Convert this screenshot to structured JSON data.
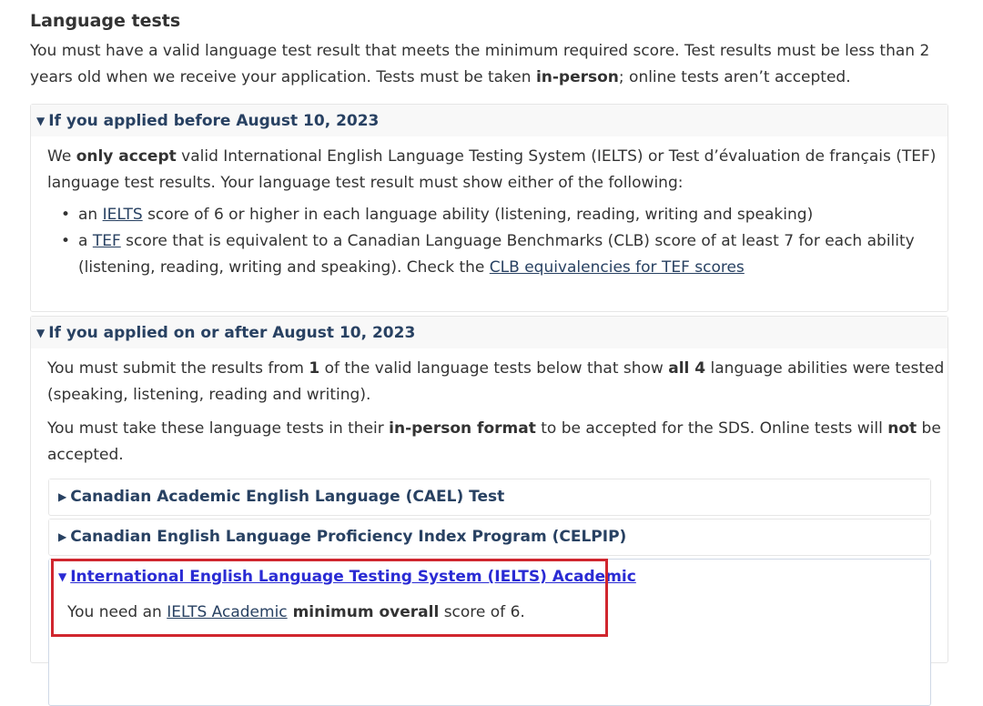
{
  "section": {
    "title": "Language tests",
    "intro_1": "You must have a valid language test result that meets the minimum required score. Test results must be less than 2 years old when we receive your application. Tests must be taken ",
    "intro_bold": "in-person",
    "intro_2": "; online tests aren’t accepted."
  },
  "before": {
    "summary": "If you applied before August 10, 2023",
    "p_1": "We ",
    "p_bold": "only accept",
    "p_2": " valid International English Language Testing System (IELTS) or Test d’évaluation de français (TEF) language test results. Your language test result must show either of the following:",
    "bullets": [
      {
        "pre": "an ",
        "link": "IELTS",
        "post": " score of 6 or higher in each language ability (listening, reading, writing and speaking)"
      },
      {
        "pre": "a ",
        "link": "TEF",
        "post": " score that is equivalent to a Canadian Language Benchmarks (CLB) score of at least 7 for each ability (listening, reading, writing and speaking). Check the ",
        "link2": "CLB equivalencies for TEF scores"
      }
    ]
  },
  "after": {
    "summary": "If you applied on or after August 10, 2023",
    "p1_1": "You must submit the results from ",
    "p1_b1": "1",
    "p1_2": " of the valid language tests below that show ",
    "p1_b2": "all 4",
    "p1_3": " language abilities were tested (speaking, listening, reading and writing).",
    "p2_1": "You must take these language tests in their ",
    "p2_b1": "in-person format",
    "p2_2": " to be accepted for the SDS. Online tests will ",
    "p2_b2": "not",
    "p2_3": " be accepted.",
    "tests": [
      {
        "label": "Canadian Academic English Language (CAEL) Test"
      },
      {
        "label": "Canadian English Language Proficiency Index Program (CELPIP)"
      },
      {
        "label": "International English Language Testing System (IELTS) Academic"
      }
    ],
    "ielts_body_1": "You need an ",
    "ielts_body_link": "IELTS Academic",
    "ielts_body_bold": " minimum overall",
    "ielts_body_2": " score of 6."
  },
  "icons": {
    "expanded": "▼",
    "collapsed": "▶"
  },
  "colors": {
    "heading_link": "#284162",
    "active_link": "#2a2bd4",
    "highlight": "#d0262e"
  }
}
